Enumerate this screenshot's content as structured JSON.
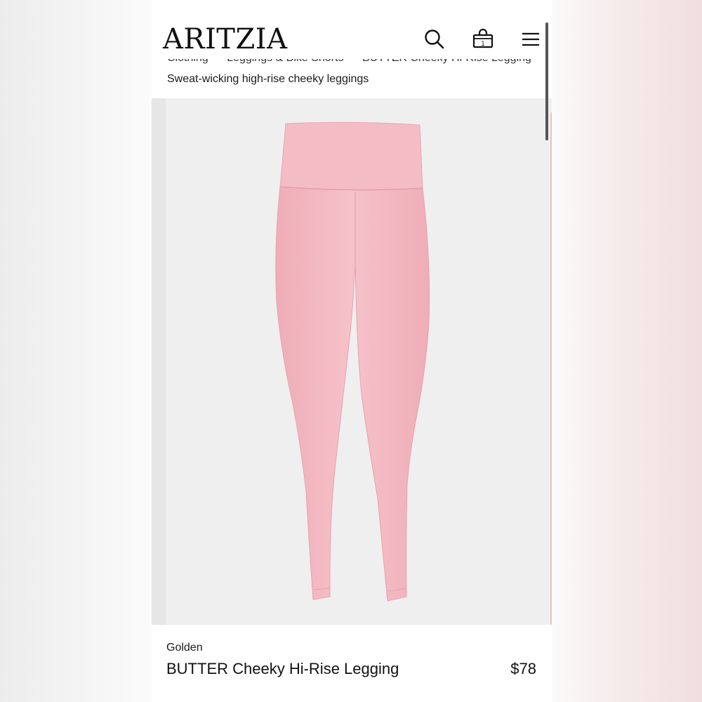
{
  "header": {
    "logo": "ARITZIA",
    "icons": [
      "search-icon",
      "bag-icon",
      "menu-icon"
    ],
    "bag_count": "1"
  },
  "breadcrumb": [
    "Clothing",
    "Leggings & Bike Shorts",
    "BUTTER Cheeky Hi-Rise Legging"
  ],
  "subtitle": "Sweat-wicking high-rise cheeky leggings",
  "product": {
    "brand": "Golden",
    "name": "BUTTER Cheeky Hi-Rise Legging",
    "price": "$78",
    "color": "#f4b9c1"
  }
}
